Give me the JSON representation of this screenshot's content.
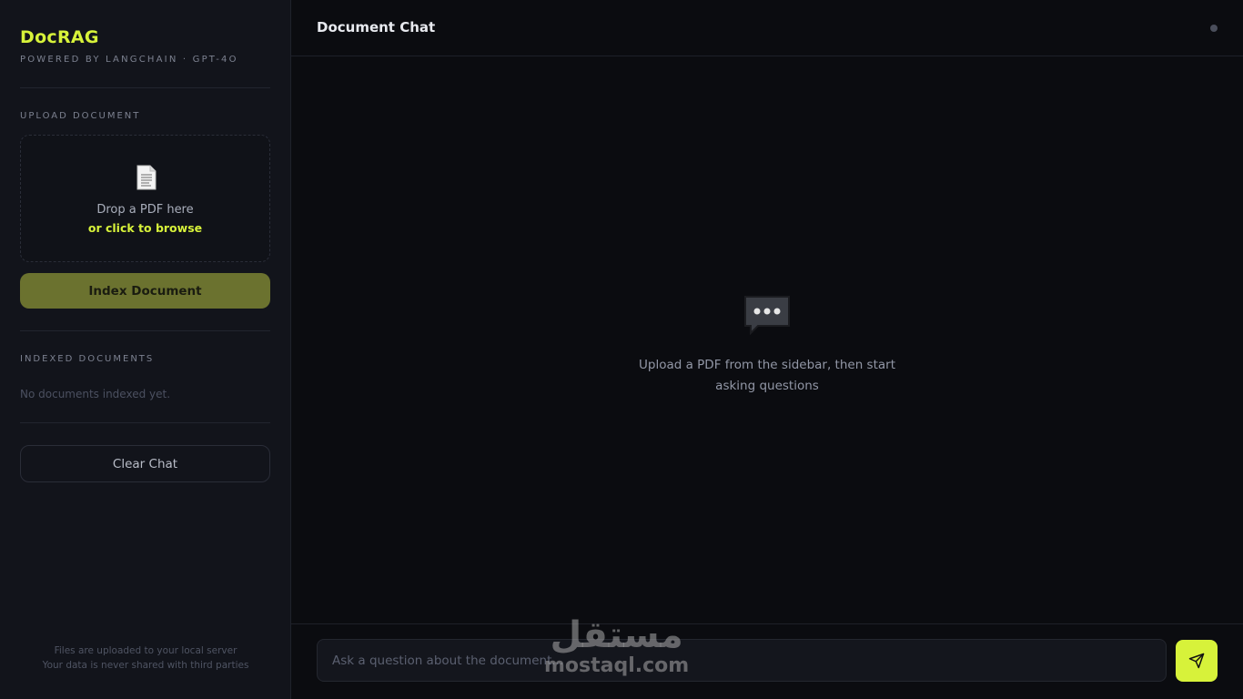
{
  "sidebar": {
    "brand_title": "DocRAG",
    "brand_subtitle": "POWERED BY LANGCHAIN · GPT-4O",
    "upload_label": "UPLOAD DOCUMENT",
    "dropzone": {
      "icon": "document-icon",
      "line1": "Drop a PDF here",
      "line2": "or click to browse"
    },
    "index_button": "Index Document",
    "indexed_label": "INDEXED DOCUMENTS",
    "no_docs_text": "No documents indexed yet.",
    "clear_button": "Clear Chat",
    "footnote_line1": "Files are uploaded to your local server",
    "footnote_line2": "Your data is never shared with third parties"
  },
  "header": {
    "title": "Document Chat"
  },
  "empty_state": {
    "icon": "speech-bubble-icon",
    "text": "Upload a PDF from the sidebar, then start asking questions"
  },
  "composer": {
    "placeholder": "Ask a question about the document...",
    "value": "",
    "send_icon": "send-icon"
  },
  "watermark": {
    "arabic": "مستقل",
    "latin": "mostaql.com"
  },
  "colors": {
    "accent": "#d7f23a",
    "index_button_bg": "#6b722f",
    "sidebar_bg": "#12141b",
    "main_bg": "#0b0c10"
  }
}
